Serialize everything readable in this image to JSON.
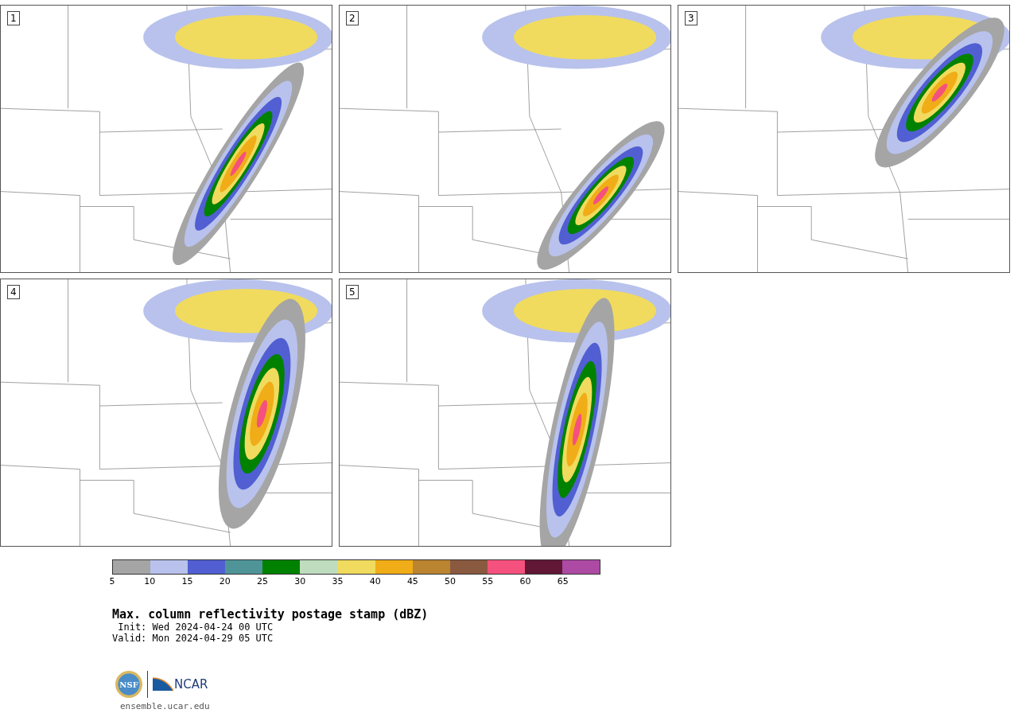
{
  "panels": [
    {
      "label": "1"
    },
    {
      "label": "2"
    },
    {
      "label": "3"
    },
    {
      "label": "4"
    },
    {
      "label": "5"
    }
  ],
  "colorbar": {
    "segments": [
      {
        "color": "#a5a5a5"
      },
      {
        "color": "#b8c2ec"
      },
      {
        "color": "#515fd3"
      },
      {
        "color": "#4f9598"
      },
      {
        "color": "#008200"
      },
      {
        "color": "#bfdcbf"
      },
      {
        "color": "#f0db5e"
      },
      {
        "color": "#f0ad17"
      },
      {
        "color": "#bb8431"
      },
      {
        "color": "#8a5a40"
      },
      {
        "color": "#f5517e"
      },
      {
        "color": "#611735"
      },
      {
        "color": "#ad4aa4"
      }
    ],
    "ticks": [
      "5",
      "10",
      "15",
      "20",
      "25",
      "30",
      "35",
      "40",
      "45",
      "50",
      "55",
      "60",
      "65"
    ]
  },
  "title": "Max. column reflectivity postage stamp (dBZ)",
  "init": " Init: Wed 2024-04-24 00 UTC",
  "valid": "Valid: Mon 2024-04-29 05 UTC",
  "logos": {
    "nsf": "NSF",
    "ncar": "NCAR"
  },
  "url": "ensemble.ucar.edu"
}
